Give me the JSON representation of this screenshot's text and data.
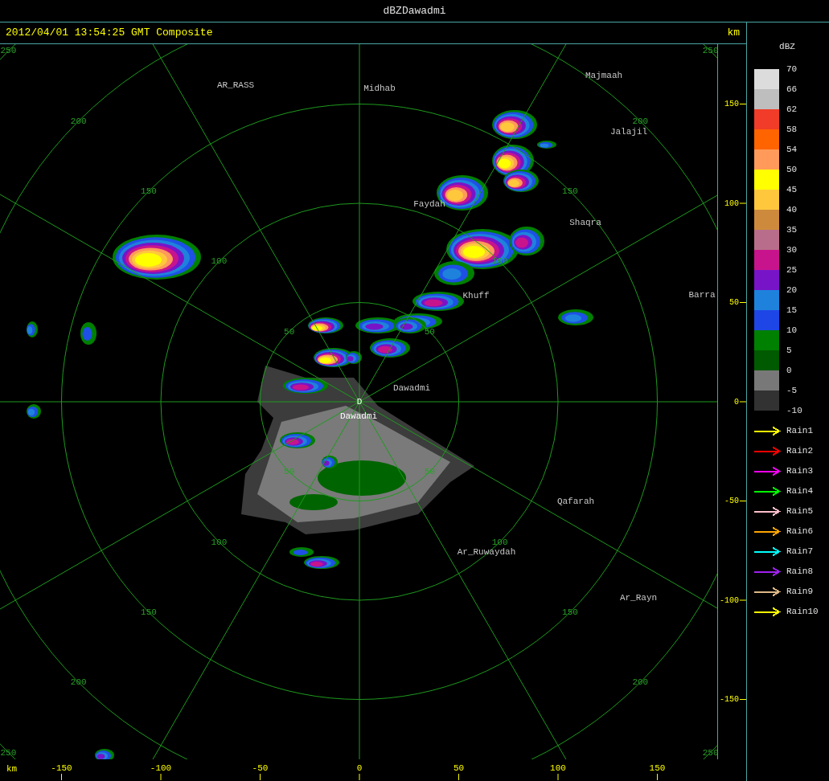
{
  "window": {
    "title": "dBZDawadmi"
  },
  "header": {
    "timestamp": "2012/04/01 13:54:25 GMT Composite",
    "unit": "km"
  },
  "plot": {
    "site": {
      "marker": "D",
      "name": "Dawadmi"
    },
    "cities": [
      "AR_RASS",
      "Midhab",
      "Majmaah",
      "Jalajil",
      "Faydah",
      "Shaqra",
      "Barra",
      "Khuff",
      "Dawadmi",
      "Qafarah",
      "Ar_Ruwaydah",
      "Ar_Rayn"
    ],
    "range_rings": [
      {
        "labels": [
          "50",
          "50",
          "50",
          "50"
        ]
      },
      {
        "labels": [
          "100",
          "100",
          "100",
          "100"
        ]
      },
      {
        "labels": [
          "150",
          "150",
          "150",
          "150"
        ]
      },
      {
        "labels": [
          "200",
          "200",
          "200",
          "200"
        ]
      },
      {
        "labels": [
          "250",
          "250",
          "250",
          "250"
        ]
      }
    ],
    "x_axis": {
      "unit": "km",
      "ticks": [
        "-150",
        "-100",
        "-50",
        "0",
        "50",
        "100",
        "150"
      ]
    },
    "y_axis": {
      "ticks": [
        "150",
        "100",
        "50",
        "0",
        "-50",
        "-100",
        "-150"
      ]
    }
  },
  "legend": {
    "title": "dBZ",
    "scale_labels": [
      "70",
      "66",
      "62",
      "58",
      "54",
      "50",
      "45",
      "40",
      "35",
      "30",
      "25",
      "20",
      "15",
      "10",
      "5",
      "0",
      "-5",
      "-10"
    ],
    "bands": [
      {
        "color": "#dcdcdc"
      },
      {
        "color": "#bebebe"
      },
      {
        "color": "#f03c28"
      },
      {
        "color": "#ff6400"
      },
      {
        "color": "#ff9a5a"
      },
      {
        "color": "#ffff00"
      },
      {
        "color": "#ffc83c"
      },
      {
        "color": "#cd8a3c"
      },
      {
        "color": "#b86e8a"
      },
      {
        "color": "#c8148c"
      },
      {
        "color": "#7814c8"
      },
      {
        "color": "#1e82dc"
      },
      {
        "color": "#1e46e6"
      },
      {
        "color": "#008000"
      },
      {
        "color": "#005a00"
      },
      {
        "color": "#787878"
      },
      {
        "color": "#323232"
      }
    ],
    "products": [
      {
        "label": "Rain1",
        "color": "#ffff00"
      },
      {
        "label": "Rain2",
        "color": "#ff0000"
      },
      {
        "label": "Rain3",
        "color": "#ff00ff"
      },
      {
        "label": "Rain4",
        "color": "#00ff00"
      },
      {
        "label": "Rain5",
        "color": "#ffc0cb"
      },
      {
        "label": "Rain6",
        "color": "#ffa500"
      },
      {
        "label": "Rain7",
        "color": "#00ffff"
      },
      {
        "label": "Rain8",
        "color": "#a020f0"
      },
      {
        "label": "Rain9",
        "color": "#deb887"
      },
      {
        "label": "Rain10",
        "color": "#ffff00"
      }
    ]
  }
}
